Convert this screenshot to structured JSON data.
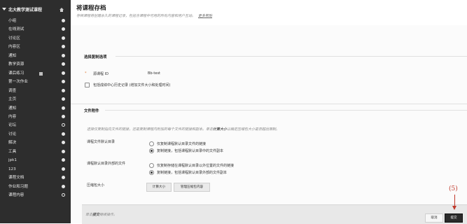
{
  "sidebar": {
    "course_title": "北大教学测试课程",
    "items": [
      {
        "label": "小组"
      },
      {
        "label": "在线测试"
      },
      {
        "label": "讨论区"
      },
      {
        "label": "内容区"
      },
      {
        "label": "通知"
      },
      {
        "label": "教学资源"
      },
      {
        "label": "课后练习",
        "badge": true
      },
      {
        "label": "第一次作业"
      },
      {
        "label": "调查"
      },
      {
        "label": "主页"
      },
      {
        "label": "通知"
      },
      {
        "label": "内容"
      },
      {
        "label": "论坛"
      },
      {
        "label": "讨论"
      },
      {
        "label": "解决"
      },
      {
        "label": "工具"
      },
      {
        "label": "jpk1"
      },
      {
        "label": "123"
      },
      {
        "label": "课程文档"
      },
      {
        "label": "作业和习题"
      },
      {
        "label": "课程内容"
      }
    ]
  },
  "header": {
    "title": "将课程存档",
    "description": "存档课程将创建永久的课程记录，包括含课程中可用的所有内容和用户互动。",
    "more_link": "更多帮助"
  },
  "copy_options": {
    "section_title": "选择复制选项",
    "course_id_label": "源课程 ID",
    "course_id_value": "Bb-test",
    "gradecenter_label": "包括成绩中心历史记录 (增加文件大小和处理时间)"
  },
  "file_attachments": {
    "section_title": "文件附件",
    "instruction_pre": "选择仅复制指向文件的链接，还是复制课程内附加的每个文件的链接和副本。单击",
    "instruction_bold": "计算大小",
    "instruction_post": "以确定压缩包大小是否超出限制。",
    "default_dir_label": "课程文件默认目录",
    "default_dir_opt1": "仅复制课程默认目录文件的链接",
    "default_dir_opt2": "复制链接，包括课程默认目录中的文件副本",
    "outside_label": "课程默认目录外部的文件",
    "outside_opt1": "仅复制存储在课程默认目录以外位置的文件的链接",
    "outside_opt2": "复制链接，包括课程默认目录外部的文件副本",
    "package_label": "压缩包大小",
    "calc_button": "计算大小",
    "manage_button": "管理压缩包内容"
  },
  "footer": {
    "hint_pre": "单击",
    "hint_bold": "提交",
    "hint_post": "继续操作。",
    "cancel": "取消",
    "submit": "提交"
  },
  "annotation": {
    "label": "(5)",
    "color": "#c0392b"
  },
  "colors": {
    "sidebar_bg": "#2d2d2d",
    "required_marker": "#e07f3b"
  }
}
